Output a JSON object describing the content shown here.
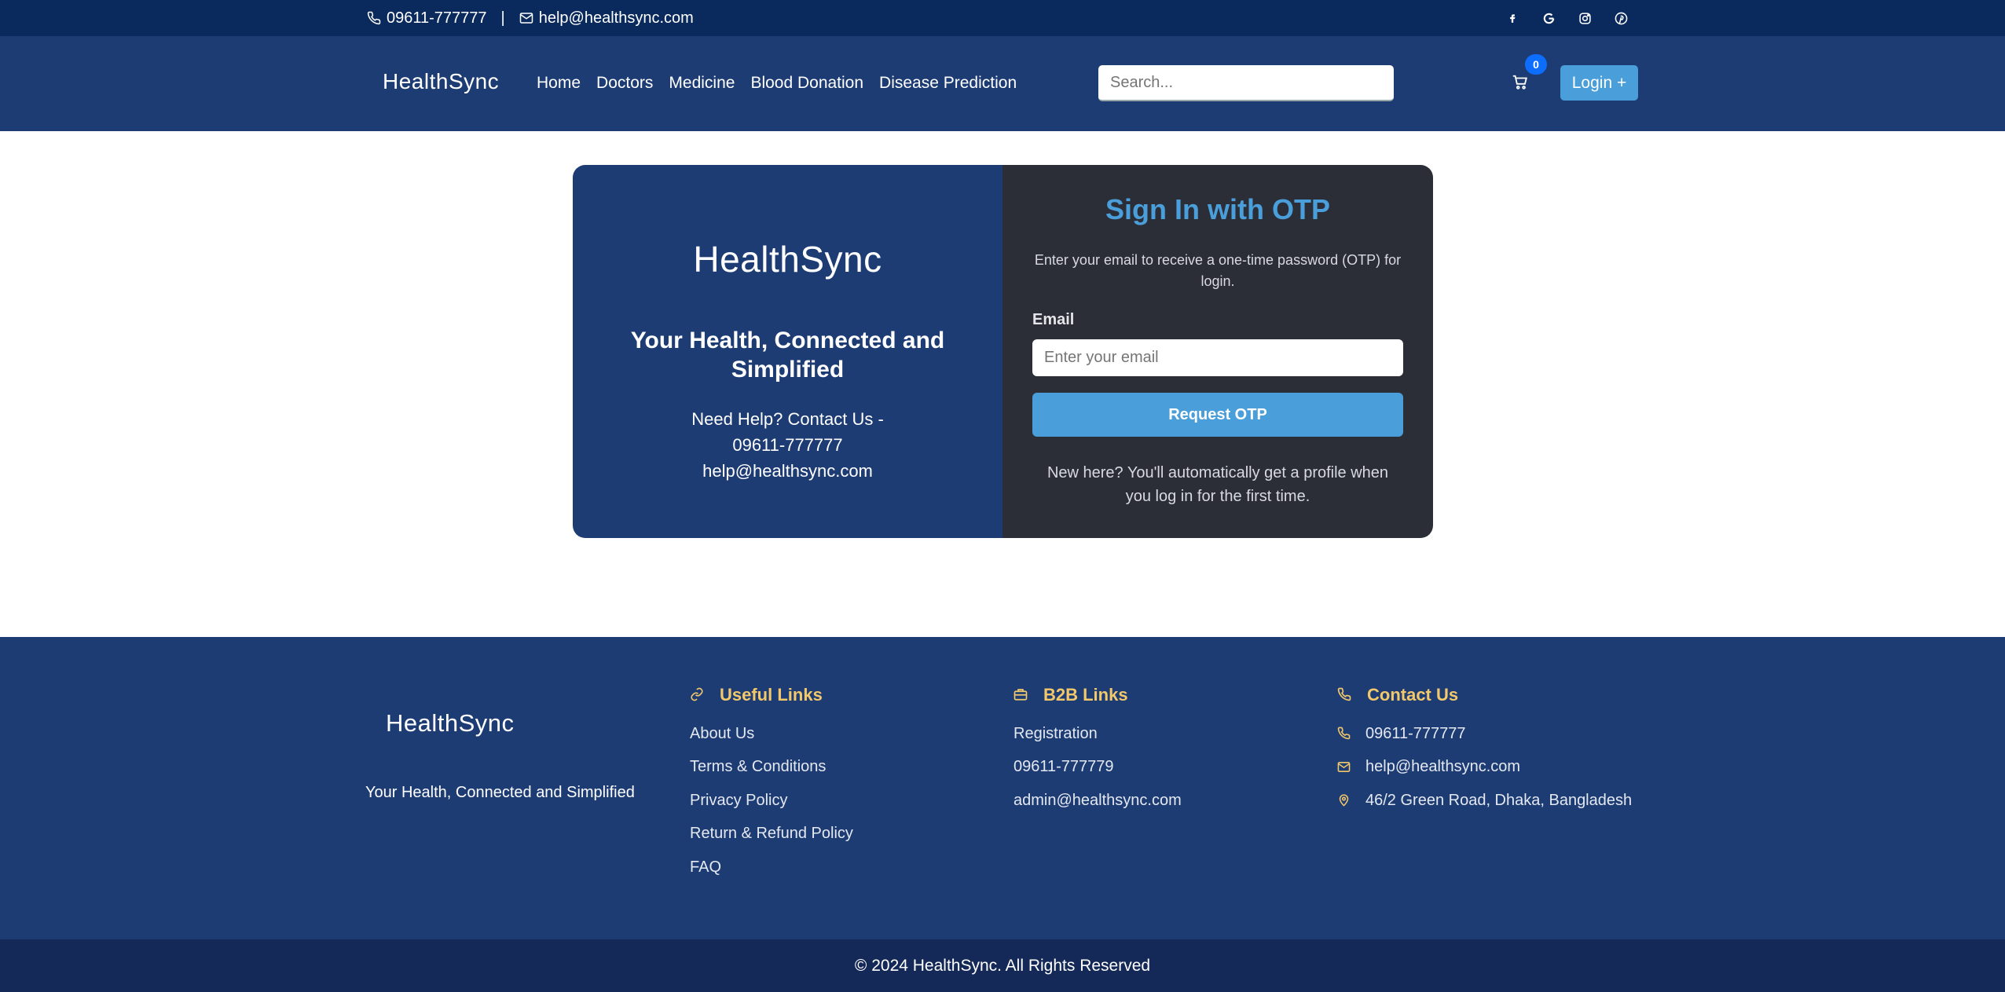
{
  "topbar": {
    "phone": "09611-777777",
    "separator": "|",
    "email": "help@healthsync.com",
    "social_icons": [
      "facebook-icon",
      "google-icon",
      "instagram-icon",
      "pinterest-icon"
    ]
  },
  "nav": {
    "logo": "HealthSync",
    "links": [
      "Home",
      "Doctors",
      "Medicine",
      "Blood Donation",
      "Disease Prediction"
    ],
    "search_placeholder": "Search...",
    "cart_count": "0",
    "login_label": "Login +"
  },
  "card": {
    "logo": "HealthSync",
    "tagline": "Your Health, Connected and Simplified",
    "help_line1": "Need Help? Contact Us -",
    "help_phone": "09611-777777",
    "help_email": "help@healthsync.com",
    "title": "Sign In with OTP",
    "description": "Enter your email to receive a one-time password (OTP) for login.",
    "email_label": "Email",
    "email_placeholder": "Enter your email",
    "button_label": "Request OTP",
    "new_here": "New here? You'll automatically get a profile when you log in for the first time."
  },
  "footer": {
    "logo": "HealthSync",
    "tagline": "Your Health, Connected and Simplified",
    "useful_links": {
      "title": "Useful Links",
      "items": [
        "About Us",
        "Terms & Conditions",
        "Privacy Policy",
        "Return & Refund Policy",
        "FAQ"
      ]
    },
    "b2b_links": {
      "title": "B2B Links",
      "items": [
        "Registration",
        "09611-777779",
        "admin@healthsync.com"
      ]
    },
    "contact": {
      "title": "Contact Us",
      "phone": "09611-777777",
      "email": "help@healthsync.com",
      "address": "46/2 Green Road, Dhaka, Bangladesh"
    },
    "copyright": "© 2024 HealthSync. All Rights Reserved"
  },
  "colors": {
    "topbar": "#0a2a5e",
    "navbar": "#1d3c74",
    "accent": "#4a9ed9",
    "card_right": "#2b2d37",
    "footer_heading": "#f2c86b",
    "copyright_bar": "#142957"
  }
}
